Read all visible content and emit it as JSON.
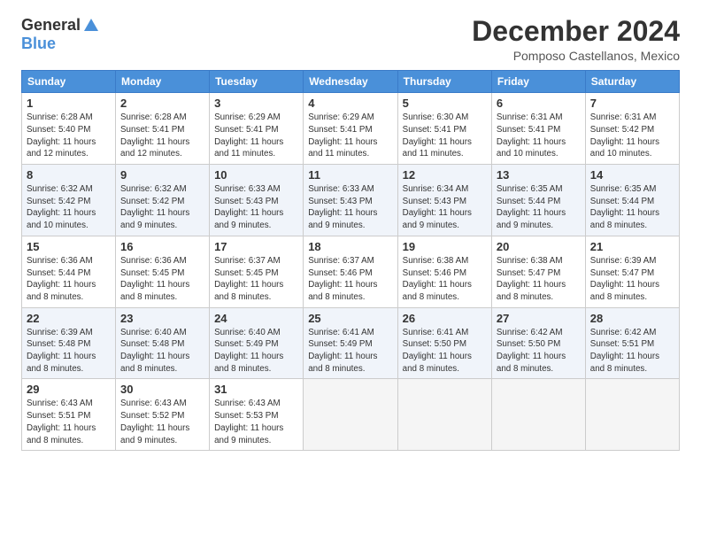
{
  "logo": {
    "general": "General",
    "blue": "Blue"
  },
  "title": "December 2024",
  "subtitle": "Pomposo Castellanos, Mexico",
  "days_of_week": [
    "Sunday",
    "Monday",
    "Tuesday",
    "Wednesday",
    "Thursday",
    "Friday",
    "Saturday"
  ],
  "weeks": [
    [
      {
        "day": "1",
        "info": "Sunrise: 6:28 AM\nSunset: 5:40 PM\nDaylight: 11 hours\nand 12 minutes."
      },
      {
        "day": "2",
        "info": "Sunrise: 6:28 AM\nSunset: 5:41 PM\nDaylight: 11 hours\nand 12 minutes."
      },
      {
        "day": "3",
        "info": "Sunrise: 6:29 AM\nSunset: 5:41 PM\nDaylight: 11 hours\nand 11 minutes."
      },
      {
        "day": "4",
        "info": "Sunrise: 6:29 AM\nSunset: 5:41 PM\nDaylight: 11 hours\nand 11 minutes."
      },
      {
        "day": "5",
        "info": "Sunrise: 6:30 AM\nSunset: 5:41 PM\nDaylight: 11 hours\nand 11 minutes."
      },
      {
        "day": "6",
        "info": "Sunrise: 6:31 AM\nSunset: 5:41 PM\nDaylight: 11 hours\nand 10 minutes."
      },
      {
        "day": "7",
        "info": "Sunrise: 6:31 AM\nSunset: 5:42 PM\nDaylight: 11 hours\nand 10 minutes."
      }
    ],
    [
      {
        "day": "8",
        "info": "Sunrise: 6:32 AM\nSunset: 5:42 PM\nDaylight: 11 hours\nand 10 minutes."
      },
      {
        "day": "9",
        "info": "Sunrise: 6:32 AM\nSunset: 5:42 PM\nDaylight: 11 hours\nand 9 minutes."
      },
      {
        "day": "10",
        "info": "Sunrise: 6:33 AM\nSunset: 5:43 PM\nDaylight: 11 hours\nand 9 minutes."
      },
      {
        "day": "11",
        "info": "Sunrise: 6:33 AM\nSunset: 5:43 PM\nDaylight: 11 hours\nand 9 minutes."
      },
      {
        "day": "12",
        "info": "Sunrise: 6:34 AM\nSunset: 5:43 PM\nDaylight: 11 hours\nand 9 minutes."
      },
      {
        "day": "13",
        "info": "Sunrise: 6:35 AM\nSunset: 5:44 PM\nDaylight: 11 hours\nand 9 minutes."
      },
      {
        "day": "14",
        "info": "Sunrise: 6:35 AM\nSunset: 5:44 PM\nDaylight: 11 hours\nand 8 minutes."
      }
    ],
    [
      {
        "day": "15",
        "info": "Sunrise: 6:36 AM\nSunset: 5:44 PM\nDaylight: 11 hours\nand 8 minutes."
      },
      {
        "day": "16",
        "info": "Sunrise: 6:36 AM\nSunset: 5:45 PM\nDaylight: 11 hours\nand 8 minutes."
      },
      {
        "day": "17",
        "info": "Sunrise: 6:37 AM\nSunset: 5:45 PM\nDaylight: 11 hours\nand 8 minutes."
      },
      {
        "day": "18",
        "info": "Sunrise: 6:37 AM\nSunset: 5:46 PM\nDaylight: 11 hours\nand 8 minutes."
      },
      {
        "day": "19",
        "info": "Sunrise: 6:38 AM\nSunset: 5:46 PM\nDaylight: 11 hours\nand 8 minutes."
      },
      {
        "day": "20",
        "info": "Sunrise: 6:38 AM\nSunset: 5:47 PM\nDaylight: 11 hours\nand 8 minutes."
      },
      {
        "day": "21",
        "info": "Sunrise: 6:39 AM\nSunset: 5:47 PM\nDaylight: 11 hours\nand 8 minutes."
      }
    ],
    [
      {
        "day": "22",
        "info": "Sunrise: 6:39 AM\nSunset: 5:48 PM\nDaylight: 11 hours\nand 8 minutes."
      },
      {
        "day": "23",
        "info": "Sunrise: 6:40 AM\nSunset: 5:48 PM\nDaylight: 11 hours\nand 8 minutes."
      },
      {
        "day": "24",
        "info": "Sunrise: 6:40 AM\nSunset: 5:49 PM\nDaylight: 11 hours\nand 8 minutes."
      },
      {
        "day": "25",
        "info": "Sunrise: 6:41 AM\nSunset: 5:49 PM\nDaylight: 11 hours\nand 8 minutes."
      },
      {
        "day": "26",
        "info": "Sunrise: 6:41 AM\nSunset: 5:50 PM\nDaylight: 11 hours\nand 8 minutes."
      },
      {
        "day": "27",
        "info": "Sunrise: 6:42 AM\nSunset: 5:50 PM\nDaylight: 11 hours\nand 8 minutes."
      },
      {
        "day": "28",
        "info": "Sunrise: 6:42 AM\nSunset: 5:51 PM\nDaylight: 11 hours\nand 8 minutes."
      }
    ],
    [
      {
        "day": "29",
        "info": "Sunrise: 6:43 AM\nSunset: 5:51 PM\nDaylight: 11 hours\nand 8 minutes."
      },
      {
        "day": "30",
        "info": "Sunrise: 6:43 AM\nSunset: 5:52 PM\nDaylight: 11 hours\nand 9 minutes."
      },
      {
        "day": "31",
        "info": "Sunrise: 6:43 AM\nSunset: 5:53 PM\nDaylight: 11 hours\nand 9 minutes."
      },
      null,
      null,
      null,
      null
    ]
  ]
}
